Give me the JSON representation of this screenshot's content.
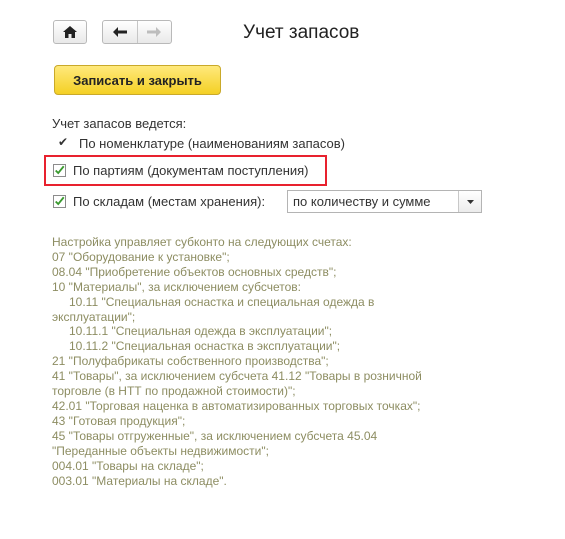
{
  "header": {
    "title": "Учет запасов",
    "home_icon": "home-icon",
    "back_icon": "arrow-left-icon",
    "forward_icon": "arrow-right-icon"
  },
  "toolbar": {
    "save_close_label": "Записать и закрыть"
  },
  "inventory": {
    "heading": "Учет запасов ведется:",
    "by_nomenclature": {
      "label": "По номенклатуре (наименованиям запасов)",
      "checked": true
    },
    "by_batches": {
      "label": "По партиям (документам поступления)",
      "checked": true
    },
    "by_warehouses": {
      "label": "По складам (местам хранения):",
      "checked": true
    },
    "warehouse_mode": {
      "value": "по количеству и сумме"
    }
  },
  "info_lines": [
    "Настройка управляет субконто на следующих счетах:",
    "07 \"Оборудование к установке\";",
    "08.04 \"Приобретение объектов основных средств\";",
    "10 \"Материалы\", за исключением субсчетов:",
    "10.11 \"Специальная оснастка и специальная одежда в",
    "эксплуатации\";",
    "10.11.1 \"Специальная одежда в эксплуатации\";",
    "10.11.2 \"Специальная оснастка в эксплуатации\";",
    "21 \"Полуфабрикаты собственного производства\";",
    "41 \"Товары\", за исключением субсчета 41.12 \"Товары в розничной",
    "торговле (в НТТ по продажной стоимости)\";",
    "42.01 \"Торговая наценка в автоматизированных торговых точках\";",
    "43 \"Готовая продукция\";",
    "45 \"Товары отгруженные\", за исключением субсчета 45.04",
    "\"Переданные объекты недвижимости\";",
    "004.01 \"Товары на складе\";",
    "003.01 \"Материалы на складе\"."
  ],
  "colors": {
    "highlight": "#e8212e",
    "save_button": "#f4d024",
    "check": "#3a9a2f",
    "info_text": "#8d8d62"
  }
}
